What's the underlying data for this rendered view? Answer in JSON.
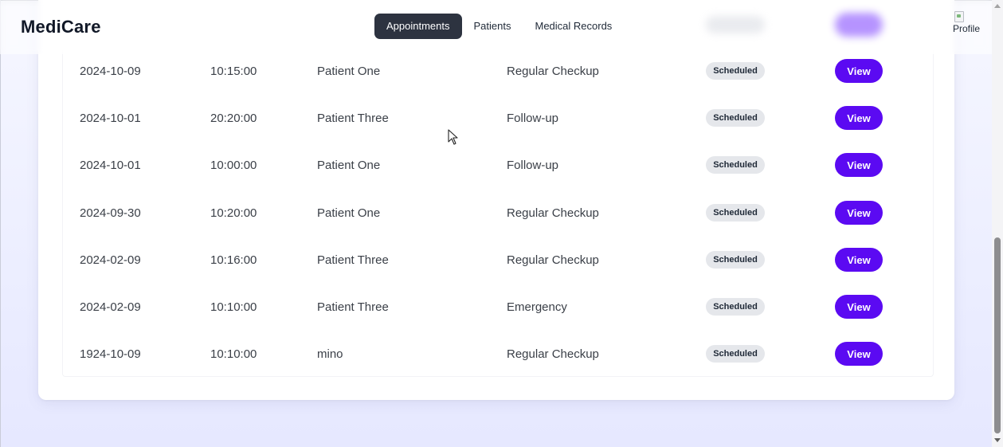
{
  "app": {
    "logo": "MediCare"
  },
  "nav": [
    {
      "label": "Appointments",
      "active": true
    },
    {
      "label": "Patients",
      "active": false
    },
    {
      "label": "Medical Records",
      "active": false
    }
  ],
  "profile": {
    "alt_text": "Profile"
  },
  "appointments": [
    {
      "date": "2024-10-09",
      "time": "10:15:00",
      "patient": "Patient One",
      "type": "Regular Checkup",
      "status": "Scheduled",
      "action": "View"
    },
    {
      "date": "2024-10-01",
      "time": "20:20:00",
      "patient": "Patient Three",
      "type": "Follow-up",
      "status": "Scheduled",
      "action": "View"
    },
    {
      "date": "2024-10-01",
      "time": "10:00:00",
      "patient": "Patient One",
      "type": "Follow-up",
      "status": "Scheduled",
      "action": "View"
    },
    {
      "date": "2024-09-30",
      "time": "10:20:00",
      "patient": "Patient One",
      "type": "Regular Checkup",
      "status": "Scheduled",
      "action": "View"
    },
    {
      "date": "2024-02-09",
      "time": "10:16:00",
      "patient": "Patient Three",
      "type": "Regular Checkup",
      "status": "Scheduled",
      "action": "View"
    },
    {
      "date": "2024-02-09",
      "time": "10:10:00",
      "patient": "Patient Three",
      "type": "Emergency",
      "status": "Scheduled",
      "action": "View"
    },
    {
      "date": "1924-10-09",
      "time": "10:10:00",
      "patient": "mino",
      "type": "Regular Checkup",
      "status": "Scheduled",
      "action": "View"
    }
  ],
  "colors": {
    "accent": "#5b0af2",
    "nav_active_bg": "#2d3340",
    "badge_bg": "#e5e7eb"
  },
  "icons": {
    "cursor": "mouse-pointer-icon",
    "broken_image": "broken-image-icon"
  }
}
